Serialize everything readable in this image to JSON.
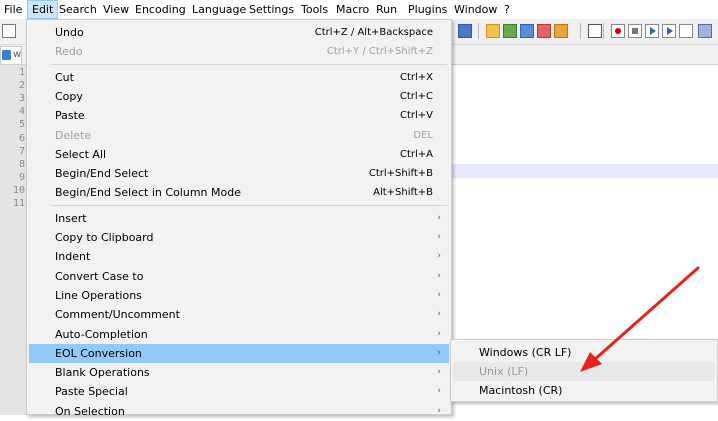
{
  "menubar": {
    "items": [
      "File",
      "Edit",
      "Search",
      "View",
      "Encoding",
      "Language",
      "Settings",
      "Tools",
      "Macro",
      "Run",
      "Plugins",
      "Window",
      "?"
    ],
    "active_index": 1
  },
  "tab": {
    "label": "w"
  },
  "line_numbers": [
    "1",
    "2",
    "3",
    "4",
    "5",
    "6",
    "7",
    "8",
    "9",
    "10",
    "11"
  ],
  "edit_menu": {
    "groups": [
      [
        {
          "label": "Undo",
          "shortcut": "Ctrl+Z / Alt+Backspace",
          "enabled": true
        },
        {
          "label": "Redo",
          "shortcut": "Ctrl+Y / Ctrl+Shift+Z",
          "enabled": false
        }
      ],
      [
        {
          "label": "Cut",
          "shortcut": "Ctrl+X",
          "enabled": true
        },
        {
          "label": "Copy",
          "shortcut": "Ctrl+C",
          "enabled": true
        },
        {
          "label": "Paste",
          "shortcut": "Ctrl+V",
          "enabled": true
        },
        {
          "label": "Delete",
          "shortcut": "DEL",
          "enabled": false
        },
        {
          "label": "Select All",
          "shortcut": "Ctrl+A",
          "enabled": true
        },
        {
          "label": "Begin/End Select",
          "shortcut": "Ctrl+Shift+B",
          "enabled": true
        },
        {
          "label": "Begin/End Select in Column Mode",
          "shortcut": "Alt+Shift+B",
          "enabled": true
        }
      ],
      [
        {
          "label": "Insert",
          "submenu": true,
          "enabled": true
        },
        {
          "label": "Copy to Clipboard",
          "submenu": true,
          "enabled": true
        },
        {
          "label": "Indent",
          "submenu": true,
          "enabled": true
        },
        {
          "label": "Convert Case to",
          "submenu": true,
          "enabled": true
        },
        {
          "label": "Line Operations",
          "submenu": true,
          "enabled": true
        },
        {
          "label": "Comment/Uncomment",
          "submenu": true,
          "enabled": true
        },
        {
          "label": "Auto-Completion",
          "submenu": true,
          "enabled": true
        },
        {
          "label": "EOL Conversion",
          "submenu": true,
          "enabled": true,
          "highlighted": true
        },
        {
          "label": "Blank Operations",
          "submenu": true,
          "enabled": true
        },
        {
          "label": "Paste Special",
          "submenu": true,
          "enabled": true
        },
        {
          "label": "On Selection",
          "submenu": true,
          "enabled": true
        }
      ]
    ],
    "submenu_arrow": "›"
  },
  "eol_submenu": {
    "items": [
      {
        "label": "Windows (CR LF)",
        "enabled": true
      },
      {
        "label": "Unix (LF)",
        "enabled": false
      },
      {
        "label": "Macintosh (CR)",
        "enabled": true
      }
    ]
  },
  "annotation": {
    "arrow_color": "#e8221b"
  },
  "colors": {
    "menu_highlight": "#91c9f7",
    "menubar_active": "#cce4f7",
    "disabled_text": "#a0a0a0"
  }
}
